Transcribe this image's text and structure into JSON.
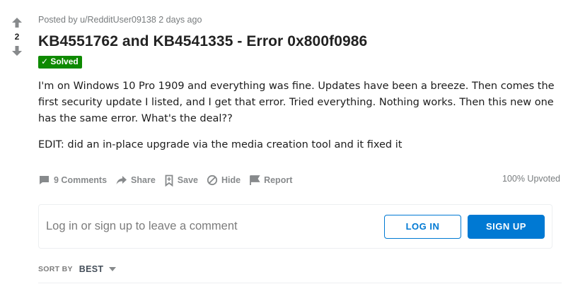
{
  "vote": {
    "count": "2"
  },
  "post": {
    "meta": "Posted by u/RedditUser09138 2 days ago",
    "title": "KB4551762 and KB4541335 - Error 0x800f0986",
    "flair": "✓ Solved",
    "body_paragraph_1": "I'm on Windows 10 Pro 1909 and everything was fine. Updates have been a breeze. Then comes the first security update I listed, and I get that error. Tried everything. Nothing works. Then this new one has the same error. What's the deal??",
    "body_paragraph_2": "EDIT: did an in-place upgrade via the media creation tool and it fixed it"
  },
  "actions": {
    "comments": "9 Comments",
    "share": "Share",
    "save": "Save",
    "hide": "Hide",
    "report": "Report",
    "upvoted": "100% Upvoted"
  },
  "login_prompt": {
    "text": "Log in or sign up to leave a comment",
    "login_button": "LOG IN",
    "signup_button": "SIGN UP"
  },
  "sort": {
    "label": "SORT BY",
    "value": "BEST"
  },
  "colors": {
    "accent": "#0079d3",
    "flair_bg": "#0e8a00",
    "muted": "#878a8c"
  },
  "icons": {
    "upvote": "arrow-up-icon",
    "downvote": "arrow-down-icon",
    "comments": "comment-bubble-icon",
    "share": "share-arrow-icon",
    "save": "bookmark-icon",
    "hide": "hide-circle-slash-icon",
    "report": "flag-icon",
    "sort": "chevron-down-icon"
  }
}
